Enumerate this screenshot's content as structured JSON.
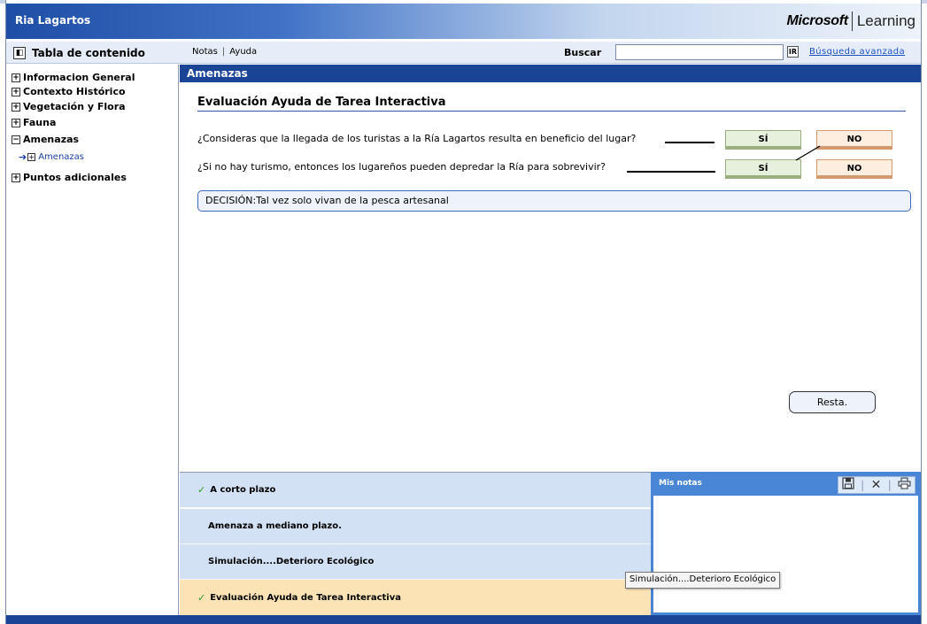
{
  "app": {
    "title": "Ria Lagartos",
    "brand": "Microsoft",
    "brand_product": "Learning"
  },
  "toolbar": {
    "toc_label": "Tabla de contenido",
    "notes_link": "Notas",
    "help_link": "Ayuda",
    "separator": "|",
    "search_label": "Buscar",
    "search_value": "",
    "search_go": "IR",
    "advanced_search": "Búsqueda avanzada"
  },
  "toc": {
    "items": [
      {
        "label": "Informacion General",
        "box": "+"
      },
      {
        "label": "Contexto Histórico",
        "box": "+"
      },
      {
        "label": "Vegetación y Flora",
        "box": "+"
      },
      {
        "label": "Fauna",
        "box": "+"
      },
      {
        "label": "Amenazas",
        "box": "−"
      },
      {
        "label": "Puntos adicionales",
        "box": "+"
      }
    ],
    "subitem": {
      "label": "Amenazas",
      "arrow": "➔",
      "box": "+"
    }
  },
  "content": {
    "header": "Amenazas",
    "section_title": "Evaluación Ayuda de Tarea Interactiva",
    "questions": [
      {
        "text": "¿Consideras que la llegada de los turistas a la Ría Lagartos resulta en beneficio del lugar?",
        "yes": "SÍ",
        "no": "NO"
      },
      {
        "text": "¿Si no hay turismo, entonces los lugareños pueden depredar la Ría para sobrevivir?",
        "yes": "SÍ",
        "no": "NO"
      }
    ],
    "decision": "DECISIÓN:Tal vez solo vivan de la pesca artesanal",
    "reset_button": "Resta."
  },
  "nav": {
    "items": [
      {
        "label": "A corto plazo",
        "checked": "✓"
      },
      {
        "label": "Amenaza a mediano plazo.",
        "checked": ""
      },
      {
        "label": "Simulación....Deterioro Ecológico",
        "checked": ""
      },
      {
        "label": "Evaluación Ayuda de Tarea Interactiva",
        "checked": "✓"
      }
    ]
  },
  "notes": {
    "title": "Mis notas",
    "save_icon": "floppy-disk-icon",
    "delete_icon": "close-icon",
    "print_icon": "printer-icon"
  },
  "tooltip": {
    "text": "Simulación....Deterioro Ecológico"
  }
}
